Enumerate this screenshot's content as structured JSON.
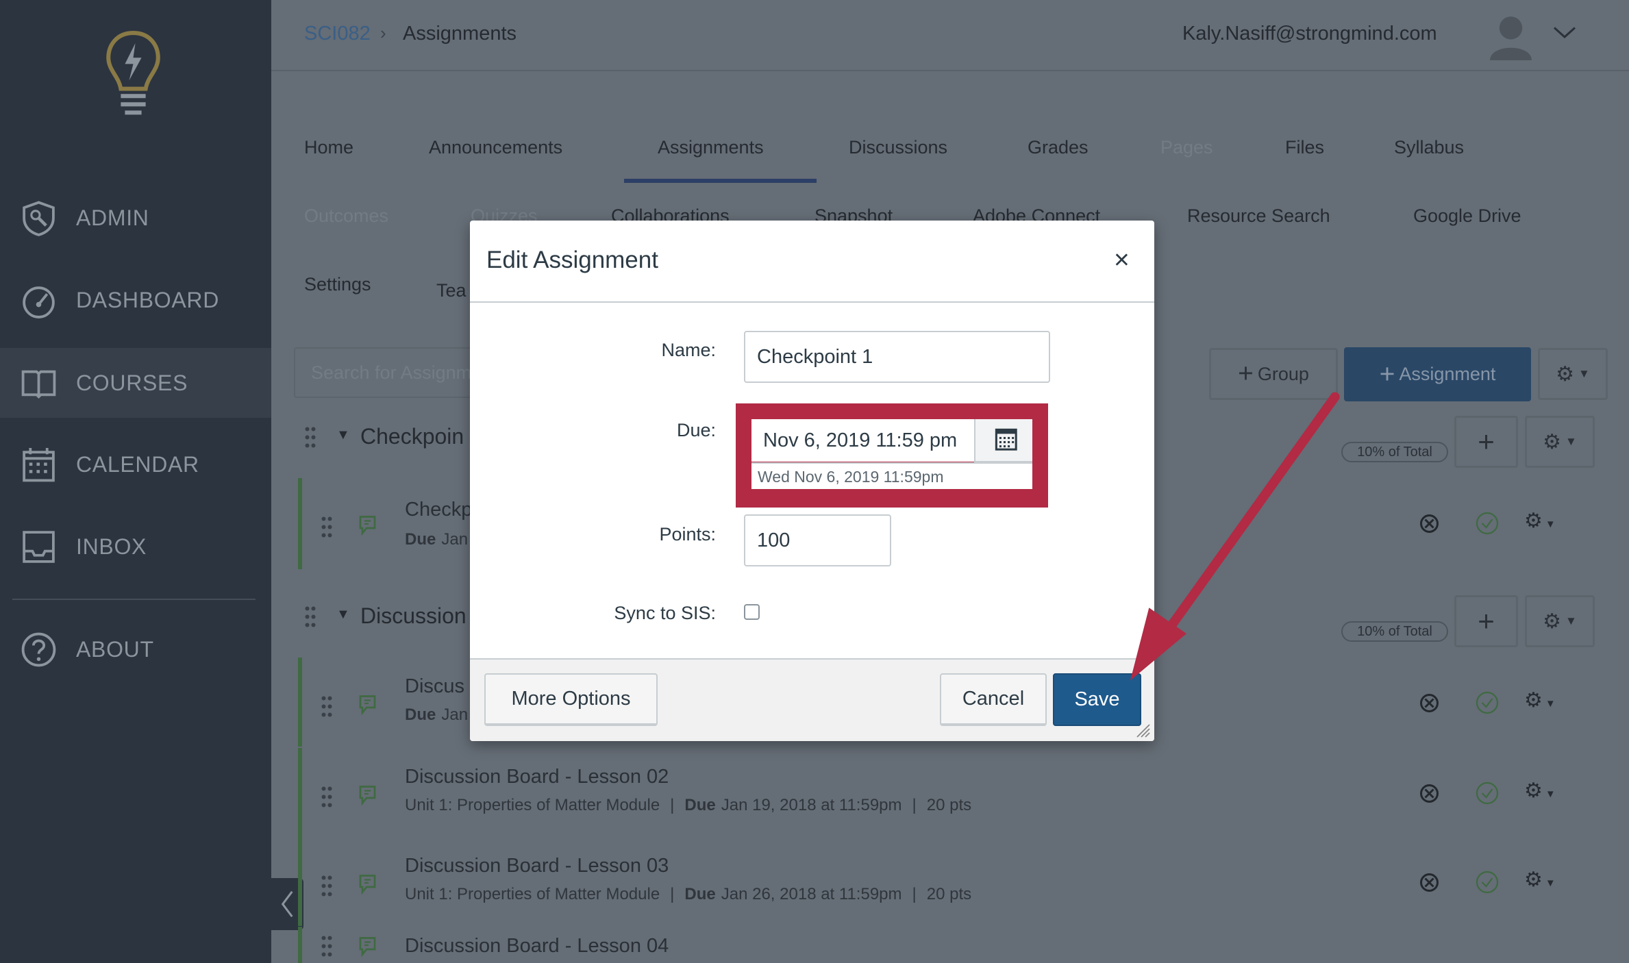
{
  "sidebar": {
    "items": [
      {
        "label": "ADMIN",
        "icon": "shield-wrench-icon"
      },
      {
        "label": "DASHBOARD",
        "icon": "speedometer-icon"
      },
      {
        "label": "COURSES",
        "icon": "book-icon",
        "active": true
      },
      {
        "label": "CALENDAR",
        "icon": "calendar-icon"
      },
      {
        "label": "INBOX",
        "icon": "inbox-icon"
      },
      {
        "label": "ABOUT",
        "icon": "question-circle-icon"
      }
    ]
  },
  "header": {
    "breadcrumb": [
      "SCI082",
      "Assignments"
    ],
    "user_email": "Kaly.Nasiff@strongmind.com"
  },
  "nav": {
    "row1": [
      "Home",
      "Announcements",
      "Assignments",
      "Discussions",
      "Grades",
      "Pages",
      "Files",
      "Syllabus"
    ],
    "row2": [
      "Outcomes",
      "Quizzes",
      "Collaborations",
      "Snapshot",
      "Adobe Connect",
      "Resource Search",
      "Google Drive"
    ],
    "row3": [
      "Settings",
      "Tea"
    ],
    "active": "Assignments"
  },
  "toolbar": {
    "search_placeholder": "Search for Assignment",
    "group_label": "Group",
    "assignment_label": "Assignment"
  },
  "groups": [
    {
      "title": "Checkpoin",
      "weight": "10% of Total",
      "items": [
        {
          "title": "Checkp",
          "due": "Due",
          "due_rest": "Jan"
        }
      ]
    },
    {
      "title": "Discussion",
      "weight": "10% of Total",
      "items": [
        {
          "title": "Discus",
          "due": "Due",
          "due_rest": "Jan"
        },
        {
          "title": "Discussion Board - Lesson 02",
          "module": "Unit 1: Properties of Matter Module",
          "due": "Due",
          "due_rest": "Jan 19, 2018 at 11:59pm",
          "points": "20 pts"
        },
        {
          "title": "Discussion Board - Lesson 03",
          "module": "Unit 1: Properties of Matter Module",
          "due": "Due",
          "due_rest": "Jan 26, 2018 at 11:59pm",
          "points": "20 pts"
        },
        {
          "title": "Discussion Board - Lesson 04"
        }
      ]
    }
  ],
  "modal": {
    "title": "Edit Assignment",
    "close": "×",
    "name_label": "Name:",
    "name_value": "Checkpoint 1",
    "due_label": "Due:",
    "due_value": "Nov 6, 2019 11:59 pm",
    "due_hint": "Wed Nov 6, 2019 11:59pm",
    "points_label": "Points:",
    "points_value": "100",
    "sync_label": "Sync to SIS:",
    "sync_checked": false,
    "more_options": "More Options",
    "cancel": "Cancel",
    "save": "Save"
  },
  "colors": {
    "sidebar": "#2c3440",
    "save": "#1f5a8c",
    "highlight": "#b22a44",
    "active_tab": "#2c3f66"
  }
}
